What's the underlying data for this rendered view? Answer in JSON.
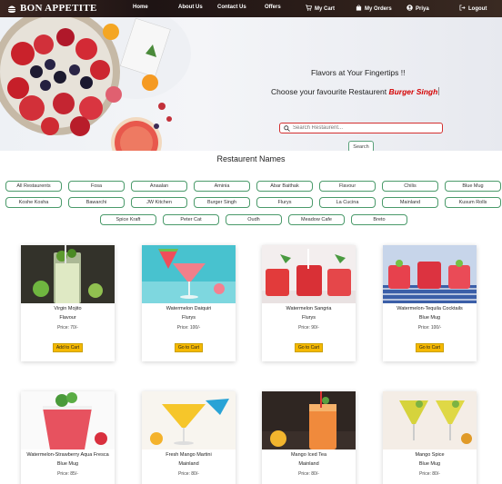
{
  "navbar": {
    "brand": "BON APPETITE",
    "links": [
      "Home",
      "About Us",
      "Contact Us",
      "Offers"
    ],
    "cart": "My Cart",
    "orders": "My Orders",
    "user": "Priya",
    "logout": "Logout"
  },
  "hero": {
    "tagline": "Flavors at Your Fingertips !!",
    "prompt_prefix": "Choose your favourite Restaurent ",
    "highlight": "Burger Singh",
    "search_placeholder": "Search Restaurent...",
    "search_button": "Search"
  },
  "section_title": "Restaurent Names",
  "restaurants": {
    "row1": [
      "All Restaurents",
      "Fosa",
      "Anaalan",
      "Aminia",
      "Abar Baithak",
      "Flavour",
      "Chilis",
      "Blue Mug"
    ],
    "row2": [
      "Koshe Kosha",
      "Bawarchi",
      "JW Kitchen",
      "Burger Singh",
      "Flurys",
      "La Cucina",
      "Mainland",
      "Kusum Rolls"
    ],
    "row3": [
      "Spice Kraft",
      "Peter Cat",
      "Oudh",
      "Meadow Cafe",
      "Breto"
    ]
  },
  "products": [
    {
      "name": "Virgin Mojito",
      "restaurant": "Flavour",
      "price": "Price: 70/-",
      "button": "Add to Cart"
    },
    {
      "name": "Watermelon Daiquiri",
      "restaurant": "Flurys",
      "price": "Price: 100/-",
      "button": "Go to Cart"
    },
    {
      "name": "Watermelon Sangria",
      "restaurant": "Flurys",
      "price": "Price: 90/-",
      "button": "Go to Cart"
    },
    {
      "name": "Watermelon-Tequila Cocktails",
      "restaurant": "Blue Mug",
      "price": "Price: 100/-",
      "button": "Go to Cart"
    },
    {
      "name": "Watermelon-Strawberry Aqua Fresca",
      "restaurant": "Blue Mug",
      "price": "Price: 85/-",
      "button": ""
    },
    {
      "name": "Fresh Mango Martini",
      "restaurant": "Mainland",
      "price": "Price: 80/-",
      "button": ""
    },
    {
      "name": "Mango Iced Tea",
      "restaurant": "Mainland",
      "price": "Price: 80/-",
      "button": ""
    },
    {
      "name": "Mango Spice",
      "restaurant": "Blue Mug",
      "price": "Price: 80/-",
      "button": ""
    }
  ],
  "colors": {
    "navbar": "#2b1d1a",
    "highlight": "#d40000",
    "button_border": "#4a9a6a",
    "cart_button": "#f5b800",
    "search_border": "#d32f2f"
  }
}
